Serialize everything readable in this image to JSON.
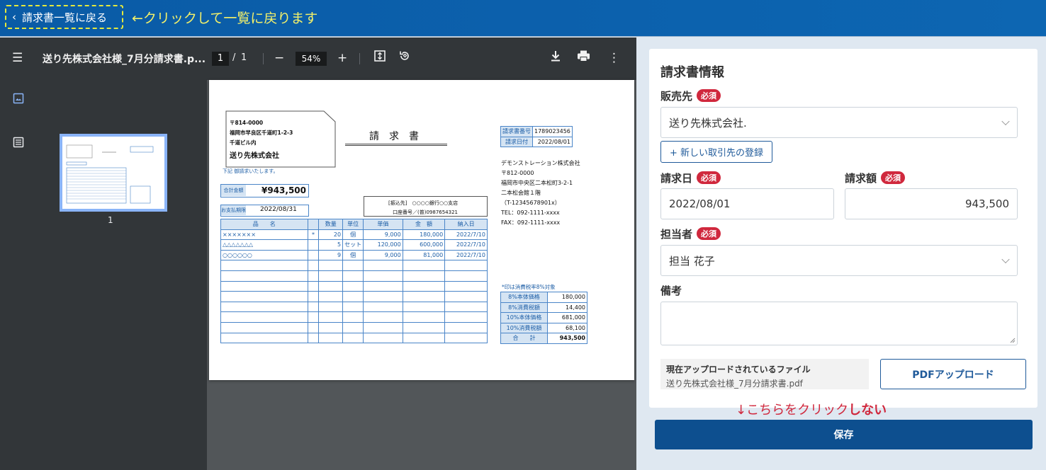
{
  "topbar": {
    "back_label": "請求書一覧に戻る",
    "back_note": "←クリックして一覧に戻ります"
  },
  "viewer": {
    "doc_title": "送り先株式会社様_7月分請求書.p...",
    "page_current": "1",
    "page_sep": "/",
    "page_total": "1",
    "zoom": "54%",
    "thumb_number": "1"
  },
  "pdf": {
    "addr": [
      "〒814-0000",
      "福岡市早良区千道町1-2-3",
      "千道ビル内"
    ],
    "addr_name": "送り先株式会社",
    "title": "請　求　書",
    "intro": "下記 御請求いたします。",
    "invoice_no_label": "請求書番号",
    "invoice_no": "1789023456",
    "invoice_date_label": "請求日付",
    "invoice_date": "2022/08/01",
    "sender": [
      "デモンストレーション株式会社",
      "〒812-0000",
      "福岡市中央区二本松町3-2-1",
      "二本松会館１階",
      "（T-12345678901x）",
      "TEL：092-1111-xxxx",
      "FAX：092-1111-xxxx"
    ],
    "total_label": "合計金額",
    "total": "¥943,500",
    "due_label": "お支払期限",
    "due": "2022/08/31",
    "bank_1": "[振込先]　○○○○銀行○○支店",
    "bank_2": "口座番号／(普)0987654321",
    "headers": [
      "品　　名",
      "",
      "数量",
      "単位",
      "単価",
      "金　額",
      "納入日"
    ],
    "rows": [
      [
        "×××××××",
        "*",
        "20",
        "個",
        "9,000",
        "180,000",
        "2022/7/10"
      ],
      [
        "△△△△△△△",
        "",
        "5",
        "セット",
        "120,000",
        "600,000",
        "2022/7/10"
      ],
      [
        "○○○○○○",
        "",
        "9",
        "個",
        "9,000",
        "81,000",
        "2022/7/10"
      ],
      [
        "",
        "",
        "",
        "",
        "",
        "",
        ""
      ],
      [
        "",
        "",
        "",
        "",
        "",
        "",
        ""
      ],
      [
        "",
        "",
        "",
        "",
        "",
        "",
        ""
      ],
      [
        "",
        "",
        "",
        "",
        "",
        "",
        ""
      ],
      [
        "",
        "",
        "",
        "",
        "",
        "",
        ""
      ],
      [
        "",
        "",
        "",
        "",
        "",
        "",
        ""
      ],
      [
        "",
        "",
        "",
        "",
        "",
        "",
        ""
      ],
      [
        "",
        "",
        "",
        "",
        "",
        "",
        ""
      ]
    ],
    "tax_note": "*印は消費税率8%対象",
    "tax_rows": [
      [
        "8%本体価格",
        "180,000"
      ],
      [
        "8%消費税額",
        "14,400"
      ],
      [
        "10%本体価格",
        "681,000"
      ],
      [
        "10%消費税額",
        "68,100"
      ],
      [
        "合　　計",
        "943,500"
      ]
    ]
  },
  "form": {
    "title": "請求書情報",
    "required": "必須",
    "customer_label": "販売先",
    "customer_value": "送り先株式会社.",
    "new_customer": "+ 新しい取引先の登録",
    "date_label": "請求日",
    "date_value": "2022/08/01",
    "amount_label": "請求額",
    "amount_value": "943,500",
    "staff_label": "担当者",
    "staff_value": "担当 花子",
    "note_label": "備考",
    "note_value": "",
    "file_label": "現在アップロードされているファイル",
    "file_name": "送り先株式会社様_7月分請求書.pdf",
    "pdf_upload": "PDFアップロード",
    "save_note_prefix": "↓こちらをクリック",
    "save_note_strong": "しない",
    "save": "保存"
  },
  "colors": {
    "topbar": "#0c61ad",
    "accent": "#0d4f8f",
    "required": "#d0283d",
    "note_yellow": "#f3f06a"
  }
}
